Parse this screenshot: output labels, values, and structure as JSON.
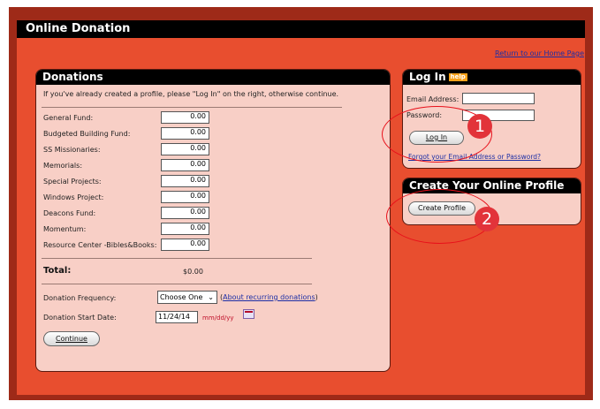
{
  "header": {
    "title": "Online Donation"
  },
  "home_link": "Return to our Home Page",
  "donations": {
    "title": "Donations",
    "intro": "If you've already created a profile, please \"Log In\" on the right, otherwise continue.",
    "funds": [
      {
        "label": "General Fund:",
        "value": "0.00"
      },
      {
        "label": "Budgeted Building Fund:",
        "value": "0.00"
      },
      {
        "label": "SS Missionaries:",
        "value": "0.00"
      },
      {
        "label": "Memorials:",
        "value": "0.00"
      },
      {
        "label": "Special Projects:",
        "value": "0.00"
      },
      {
        "label": "Windows Project:",
        "value": "0.00"
      },
      {
        "label": "Deacons Fund:",
        "value": "0.00"
      },
      {
        "label": "Momentum:",
        "value": "0.00"
      },
      {
        "label": "Resource Center -Bibles&Books:",
        "value": "0.00"
      }
    ],
    "total_label": "Total:",
    "total_value": "$0.00",
    "frequency_label": "Donation Frequency:",
    "frequency_value": "Choose One",
    "frequency_link": "About recurring donations",
    "start_date_label": "Donation Start Date:",
    "start_date_value": "11/24/14",
    "date_format": "mm/dd/yy",
    "continue_label": "Continue"
  },
  "login": {
    "title": "Log In",
    "help": "help",
    "email_label": "Email Address:",
    "password_label": "Password:",
    "button": "Log In",
    "forgot": "Forgot your Email Address or Password?"
  },
  "profile": {
    "title": "Create Your Online Profile",
    "button": "Create Profile"
  },
  "annotations": [
    "1",
    "2"
  ],
  "colors": {
    "page_bg": "#e84e2f",
    "panel_bg": "#f8cfc6",
    "annotation": "#e8101a"
  }
}
